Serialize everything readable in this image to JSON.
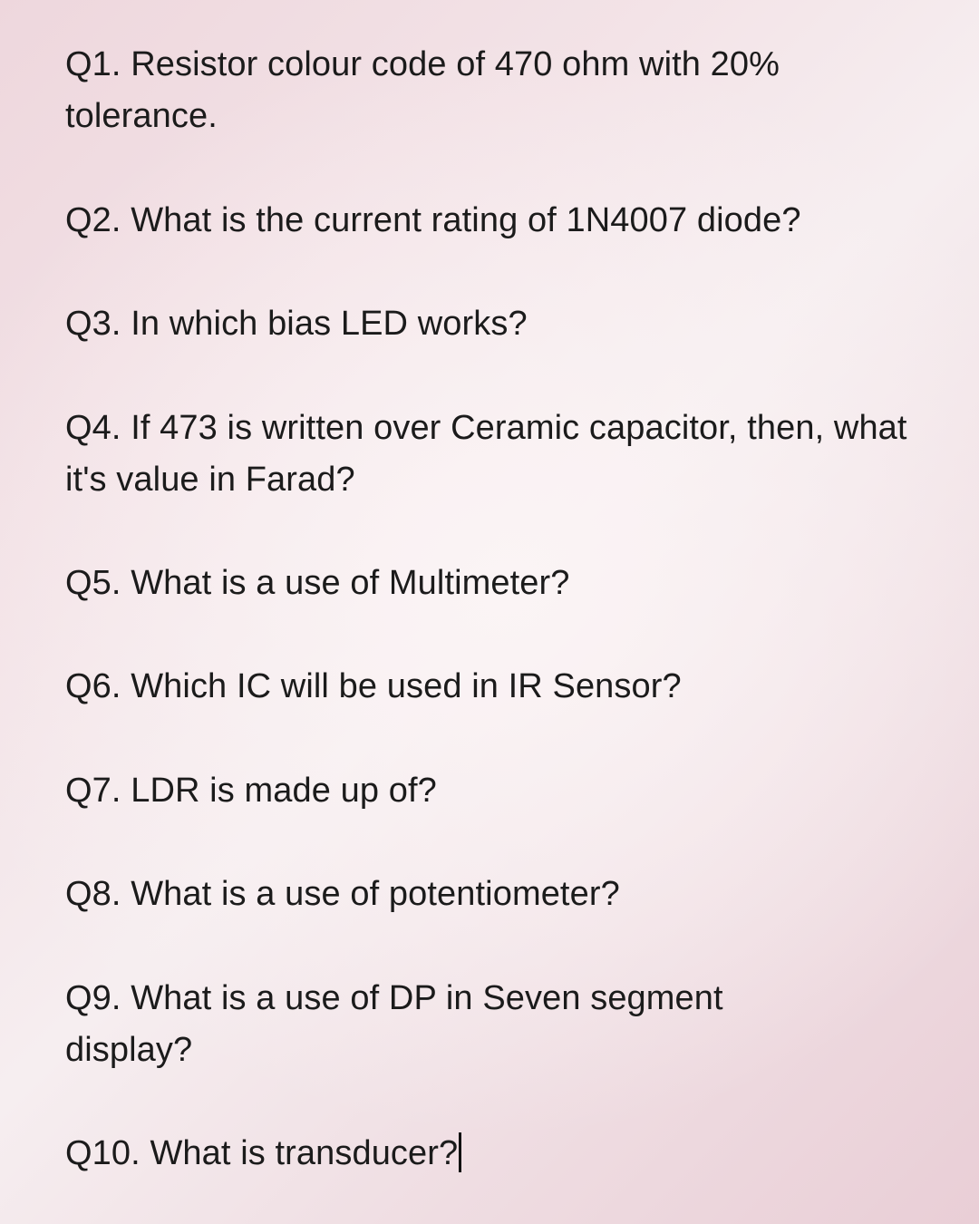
{
  "questions": [
    "Q1. Resistor colour code of 470 ohm with 20% tolerance.",
    "Q2. What is the current rating of 1N4007 diode?",
    "Q3. In which bias LED works?",
    "Q4. If 473 is written over Ceramic capacitor, then, what it's value in Farad?",
    "Q5. What is a use of Multimeter?",
    "Q6. Which IC will be used in IR Sensor?",
    "Q7. LDR is made up of?",
    "Q8. What is a use of potentiometer?",
    "Q9. What is a use of DP in Seven segment display?",
    "Q10. What is transducer?"
  ]
}
